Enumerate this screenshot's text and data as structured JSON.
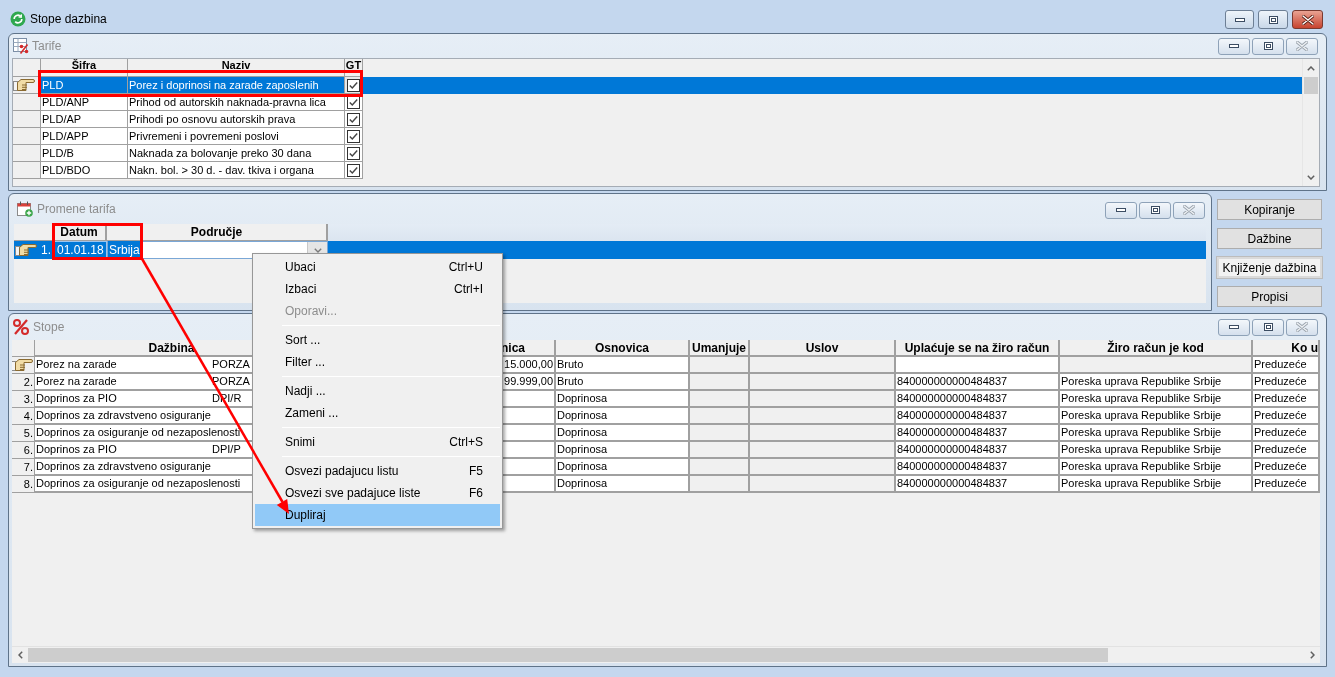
{
  "window": {
    "title": "Stope dazbina"
  },
  "tarife": {
    "title": "Tarife",
    "columns": [
      "Šifra",
      "Naziv",
      "GT"
    ],
    "rows": [
      {
        "sifra": "PLD",
        "naziv": "Porez i doprinosi na zarade zaposlenih",
        "gt": true,
        "selected": true
      },
      {
        "sifra": "PLD/ANP",
        "naziv": "Prihod od autorskih naknada-pravna lica",
        "gt": true,
        "selected": false
      },
      {
        "sifra": "PLD/AP",
        "naziv": "Prihodi po osnovu autorskih prava",
        "gt": true,
        "selected": false
      },
      {
        "sifra": "PLD/APP",
        "naziv": "Privremeni i povremeni poslovi",
        "gt": true,
        "selected": false
      },
      {
        "sifra": "PLD/B",
        "naziv": "Naknada za bolovanje preko 30 dana",
        "gt": true,
        "selected": false
      },
      {
        "sifra": "PLD/BDO",
        "naziv": "Nakn. bol. > 30 d. - dav. tkiva i organa",
        "gt": true,
        "selected": false
      }
    ]
  },
  "promene_tarifa": {
    "title": "Promene tarifa",
    "columns": [
      "Datum",
      "Područje"
    ],
    "rows": [
      {
        "number": "1.",
        "datum": "01.01.18",
        "podrucje": "Srbija",
        "selected": true
      }
    ]
  },
  "side_buttons": [
    {
      "label": "Kopiranje",
      "focused": false
    },
    {
      "label": "Dažbine",
      "focused": false
    },
    {
      "label": "Knjiženje dažbina",
      "focused": true
    },
    {
      "label": "Propisi",
      "focused": false
    }
  ],
  "stope": {
    "title": "Stope",
    "columns": [
      {
        "label": "Dažbina",
        "readonly": false
      },
      {
        "label": "nica",
        "readonly": false
      },
      {
        "label": "Osnovica",
        "readonly": false
      },
      {
        "label": "Umanjuje",
        "readonly": true
      },
      {
        "label": "Uslov",
        "readonly": true
      },
      {
        "label": "Uplaćuje se na žiro račun",
        "readonly": false
      },
      {
        "label": "Žiro račun je kod",
        "readonly": false
      },
      {
        "label": "Ko u",
        "readonly": false
      }
    ],
    "rows": [
      {
        "selected": true,
        "dazbina": "Porez na zarade",
        "code": "PORZA",
        "amount": "15.000,00",
        "osnovica": "Bruto",
        "ko": "Preduzeće",
        "kod_readonly": true
      },
      {
        "number": "2.",
        "selected": false,
        "dazbina": "Porez na zarade",
        "code": "PORZA",
        "amount": "99.999,00",
        "osnovica": "Bruto",
        "account": "840000000000484837",
        "kod": "Poreska uprava Republike Srbije",
        "ko": "Preduzeće",
        "kod_readonly": false
      },
      {
        "number": "3.",
        "selected": false,
        "dazbina": "Doprinos za PIO",
        "code": "DPI/R",
        "osnovica": "Doprinosa",
        "account": "840000000000484837",
        "kod": "Poreska uprava Republike Srbije",
        "ko": "Preduzeće",
        "kod_readonly": false
      },
      {
        "number": "4.",
        "selected": false,
        "dazbina": "Doprinos za zdravstveno osiguranje",
        "osnovica": "Doprinosa",
        "account": "840000000000484837",
        "kod": "Poreska uprava Republike Srbije",
        "ko": "Preduzeće",
        "kod_readonly": false
      },
      {
        "number": "5.",
        "selected": false,
        "dazbina": "Doprinos za osiguranje od nezaposlenosti",
        "osnovica": "Doprinosa",
        "account": "840000000000484837",
        "kod": "Poreska uprava Republike Srbije",
        "ko": "Preduzeće",
        "kod_readonly": false
      },
      {
        "number": "6.",
        "selected": false,
        "dazbina": "Doprinos za PIO",
        "code": "DPI/P",
        "osnovica": "Doprinosa",
        "account": "840000000000484837",
        "kod": "Poreska uprava Republike Srbije",
        "ko": "Preduzeće",
        "kod_readonly": false
      },
      {
        "number": "7.",
        "selected": false,
        "dazbina": "Doprinos za zdravstveno osiguranje",
        "osnovica": "Doprinosa",
        "account": "840000000000484837",
        "kod": "Poreska uprava Republike Srbije",
        "ko": "Preduzeće",
        "kod_readonly": false
      },
      {
        "number": "8.",
        "selected": false,
        "dazbina": "Doprinos za osiguranje od nezaposlenosti",
        "osnovica": "Doprinosa",
        "account": "840000000000484837",
        "kod": "Poreska uprava Republike Srbije",
        "ko": "Preduzeće",
        "kod_readonly": false
      }
    ]
  },
  "context_menu": {
    "items": [
      {
        "kind": "item",
        "label": "Ubaci",
        "shortcut": "Ctrl+U",
        "disabled": false,
        "selected": false
      },
      {
        "kind": "item",
        "label": "Izbaci",
        "shortcut": "Ctrl+I",
        "disabled": false,
        "selected": false
      },
      {
        "kind": "item",
        "label": "Oporavi...",
        "disabled": true,
        "selected": false
      },
      {
        "kind": "separator"
      },
      {
        "kind": "item",
        "label": "Sort ...",
        "disabled": false,
        "selected": false
      },
      {
        "kind": "item",
        "label": "Filter ...",
        "disabled": false,
        "selected": false
      },
      {
        "kind": "separator"
      },
      {
        "kind": "item",
        "label": "Nadji ...",
        "disabled": false,
        "selected": false
      },
      {
        "kind": "item",
        "label": "Zameni ...",
        "disabled": false,
        "selected": false
      },
      {
        "kind": "separator"
      },
      {
        "kind": "item",
        "label": "Snimi",
        "shortcut": "Ctrl+S",
        "disabled": false,
        "selected": false
      },
      {
        "kind": "separator"
      },
      {
        "kind": "item",
        "label": "Osvezi padajucu listu",
        "shortcut": "F5",
        "disabled": false,
        "selected": false
      },
      {
        "kind": "item",
        "label": "Osvezi sve padajuce liste",
        "shortcut": "F6",
        "disabled": false,
        "selected": false
      },
      {
        "kind": "item",
        "label": "Dupliraj",
        "disabled": false,
        "selected": true
      }
    ]
  }
}
